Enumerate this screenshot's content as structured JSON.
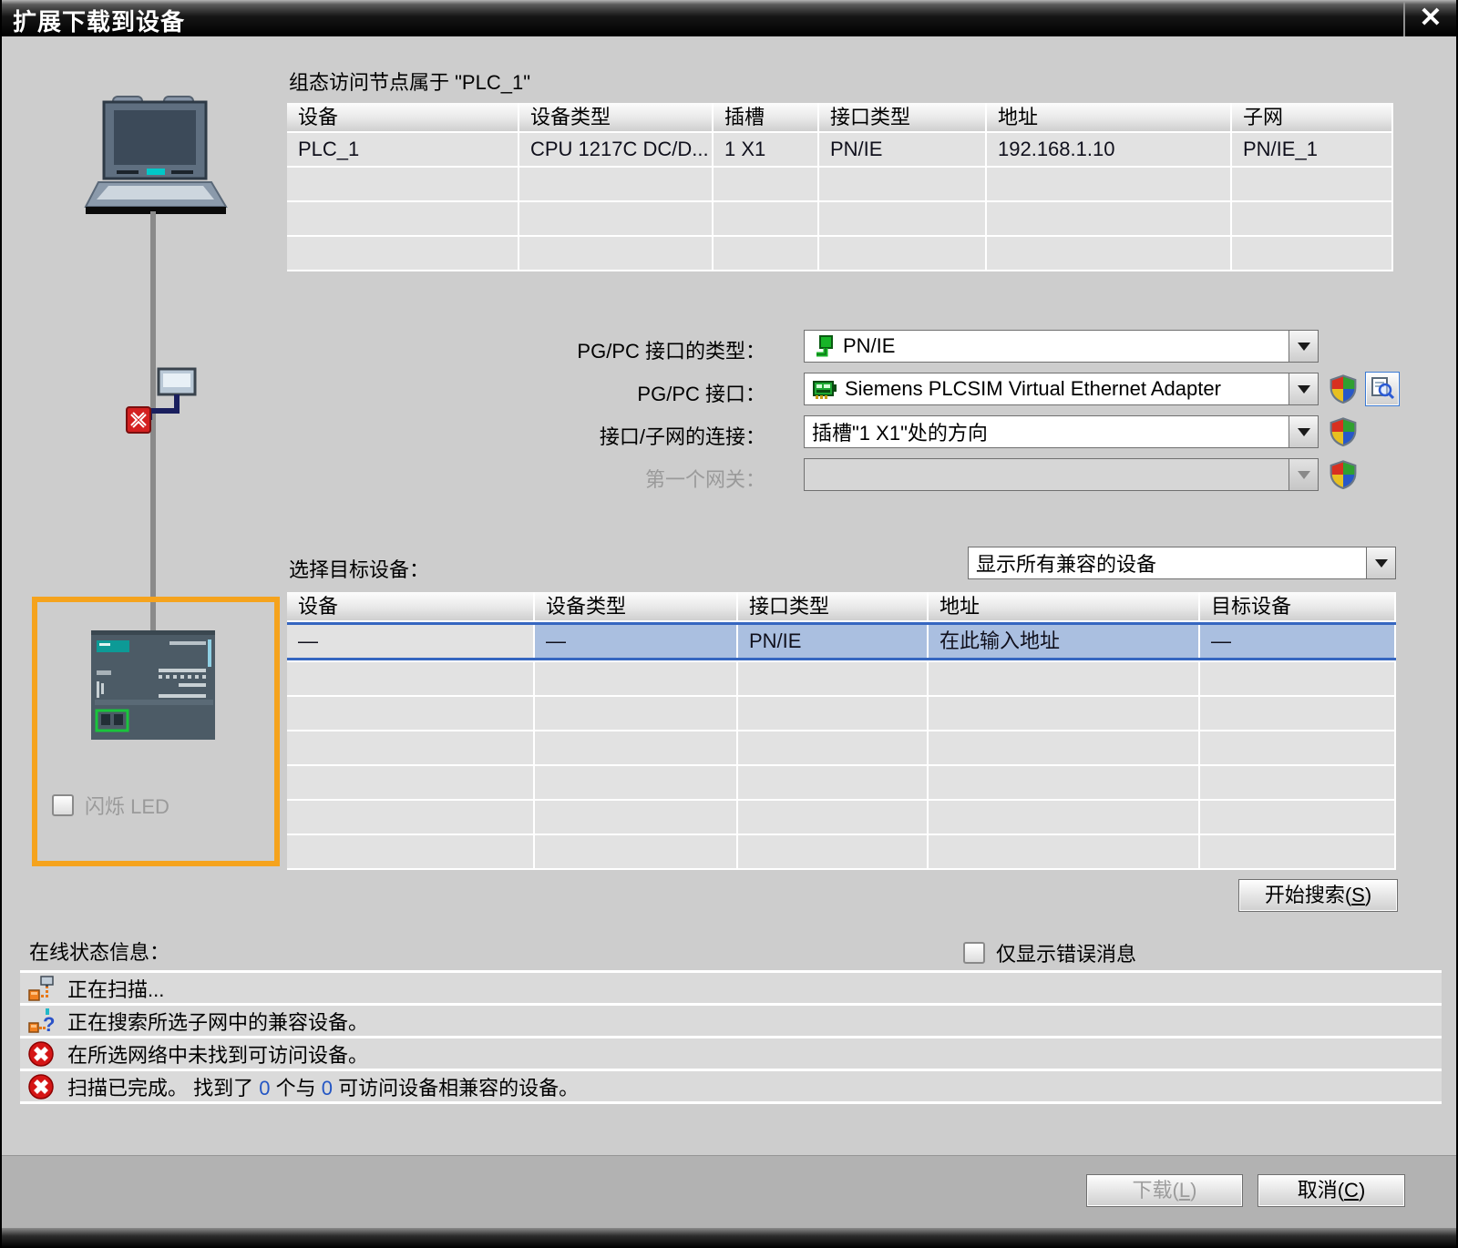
{
  "title_bar": {
    "title": "扩展下载到设备",
    "close_icon": "✕"
  },
  "accessible_nodes": {
    "heading": "组态访问节点属于 \"PLC_1\"",
    "columns": [
      "设备",
      "设备类型",
      "插槽",
      "接口类型",
      "地址",
      "子网"
    ],
    "row": [
      "PLC_1",
      "CPU 1217C DC/D...",
      "1 X1",
      "PN/IE",
      "192.168.1.10",
      "PN/IE_1"
    ]
  },
  "pgpc": {
    "type_label": "PG/PC 接口的类型：",
    "type_value": "PN/IE",
    "interface_label": "PG/PC 接口：",
    "interface_value": "Siemens PLCSIM Virtual Ethernet Adapter",
    "connection_label": "接口/子网的连接：",
    "connection_value": "插槽\"1 X1\"处的方向",
    "gateway_label": "第一个网关：",
    "gateway_value": ""
  },
  "target": {
    "select_label": "选择目标设备：",
    "filter_value": "显示所有兼容的设备",
    "columns": [
      "设备",
      "设备类型",
      "接口类型",
      "地址",
      "目标设备"
    ],
    "row": [
      "—",
      "—",
      "PN/IE",
      "在此输入地址",
      "—"
    ],
    "flash_led_label": "闪烁 LED",
    "search_button": {
      "pre": "开始搜索(",
      "key": "S",
      "post": ")"
    }
  },
  "status": {
    "heading": "在线状态信息：",
    "errors_only_label": "仅显示错误消息",
    "messages": [
      {
        "icon": "scan-icon",
        "text": "正在扫描..."
      },
      {
        "icon": "search-question-icon",
        "text": "正在搜索所选子网中的兼容设备。"
      },
      {
        "icon": "error-icon",
        "text": "在所选网络中未找到可访问设备。"
      },
      {
        "icon": "error-icon",
        "pre": "扫描已完成。 找到了 ",
        "n1": "0",
        "mid": " 个与 ",
        "n2": "0",
        "post": " 可访问设备相兼容的设备。"
      }
    ]
  },
  "footer": {
    "download_button": {
      "pre": "下载(",
      "key": "L",
      "post": ")"
    },
    "cancel_button": {
      "pre": "取消(",
      "key": "C",
      "post": ")"
    }
  },
  "colors": {
    "highlight_orange": "#f5a31d",
    "selection_blue": "#aabfe0",
    "accent_blue": "#3566c0",
    "error_red": "#d51616",
    "titlebar_black": "#000000"
  }
}
